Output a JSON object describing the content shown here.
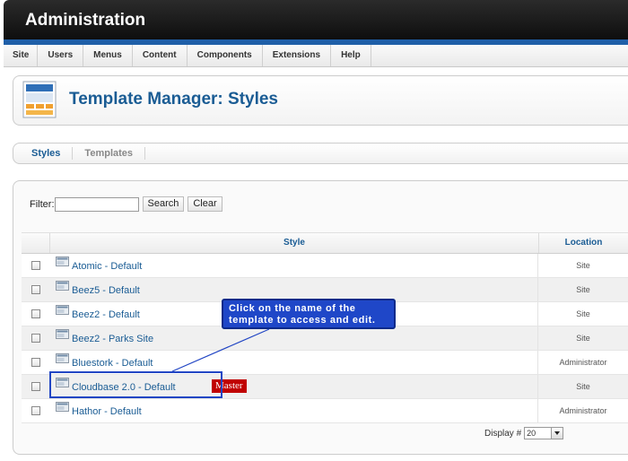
{
  "header": {
    "title": "Administration"
  },
  "menu": {
    "items": [
      "Site",
      "Users",
      "Menus",
      "Content",
      "Components",
      "Extensions",
      "Help"
    ]
  },
  "toolbar": {
    "title": "Template Manager: Styles",
    "icon": "template-manager-icon"
  },
  "subtabs": {
    "styles": "Styles",
    "templates": "Templates",
    "active": "Styles"
  },
  "filter": {
    "label": "Filter:",
    "value": "",
    "search_button": "Search",
    "clear_button": "Clear"
  },
  "table": {
    "columns": {
      "style": "Style",
      "location": "Location"
    },
    "rows": [
      {
        "style": "Atomic - Default",
        "location": "Site",
        "master": ""
      },
      {
        "style": "Beez5 - Default",
        "location": "Site",
        "master": ""
      },
      {
        "style": "Beez2 - Default",
        "location": "Site",
        "master": ""
      },
      {
        "style": "Beez2 - Parks Site",
        "location": "Site",
        "master": ""
      },
      {
        "style": "Bluestork - Default",
        "location": "Administrator",
        "master": ""
      },
      {
        "style": "Cloudbase 2.0 - Default",
        "location": "Site",
        "master": "Master"
      },
      {
        "style": "Hathor - Default",
        "location": "Administrator",
        "master": ""
      }
    ]
  },
  "display": {
    "label": "Display #",
    "value": "20"
  },
  "annotation": {
    "line1": "Click on the name of the",
    "line2": "template to access and edit."
  },
  "colors": {
    "accent": "#1a5c94",
    "header": "#1f5fa8",
    "master_badge": "#c00000",
    "callout": "#1f47c8"
  }
}
